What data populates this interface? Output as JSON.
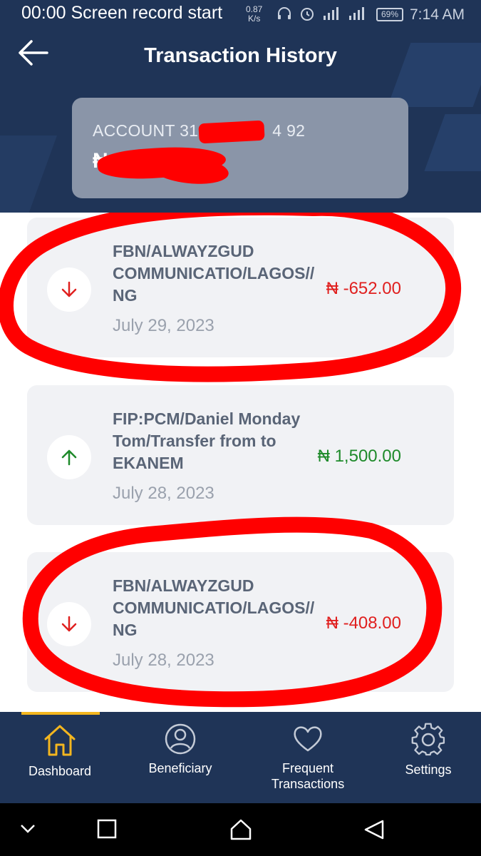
{
  "status_bar": {
    "recording_text": "00:00 Screen record start",
    "speed_value": "0.87",
    "speed_unit": "K/s",
    "battery": "69%",
    "time": "7:14 AM"
  },
  "header": {
    "title": "Transaction History",
    "account_label": "ACCOUNT 31",
    "account_suffix": "4 92",
    "currency_symbol": "₦"
  },
  "transactions": [
    {
      "direction": "debit",
      "description": "FBN/ALWAYZGUD COMMUNICATIO/LAGOS// NG",
      "amount": "₦ -652.00",
      "date": "July 29, 2023"
    },
    {
      "direction": "credit",
      "description": "FIP:PCM/Daniel Monday Tom/Transfer from to EKANEM",
      "amount": "₦ 1,500.00",
      "date": "July 28, 2023"
    },
    {
      "direction": "debit",
      "description": "FBN/ALWAYZGUD COMMUNICATIO/LAGOS// NG",
      "amount": "₦ -408.00",
      "date": "July 28, 2023"
    }
  ],
  "bottom_nav": {
    "items": [
      {
        "label": "Dashboard",
        "icon": "home-icon",
        "active": true
      },
      {
        "label": "Beneficiary",
        "icon": "user-icon",
        "active": false
      },
      {
        "label": "Frequent Transactions",
        "icon": "heart-icon",
        "active": false
      },
      {
        "label": "Settings",
        "icon": "gear-icon",
        "active": false
      }
    ]
  },
  "colors": {
    "brand_navy": "#1f3457",
    "active_accent": "#f3b61f",
    "debit": "#e0201f",
    "credit": "#1e8a2a",
    "annotation_red": "#ff0000"
  }
}
